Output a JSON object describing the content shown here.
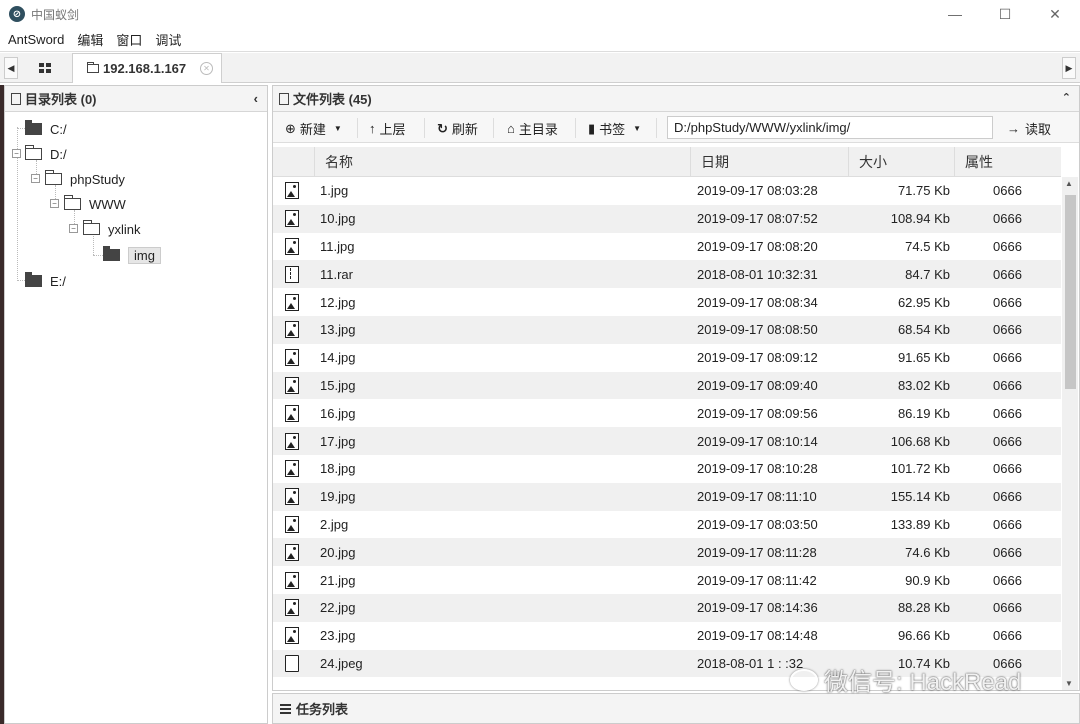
{
  "window": {
    "title": "中国蚁剑",
    "minimize": "—",
    "maximize": "☐",
    "close": "✕"
  },
  "menu": [
    "AntSword",
    "编辑",
    "窗口",
    "调试"
  ],
  "tabs": {
    "active_tab": "192.168.1.167",
    "left_arrow": "◀",
    "right_arrow": "▶"
  },
  "dir_panel": {
    "title": "目录列表 (0)",
    "collapse_icon": "‹",
    "tree": [
      {
        "label": "C:/"
      },
      {
        "label": "D:/"
      },
      {
        "label": "phpStudy"
      },
      {
        "label": "WWW"
      },
      {
        "label": "yxlink"
      },
      {
        "label": "img"
      },
      {
        "label": "E:/"
      }
    ]
  },
  "file_panel": {
    "title": "文件列表 (45)",
    "collapse_icon": "⌃",
    "toolbar": {
      "new_label": "新建",
      "up_label": "上层",
      "refresh_label": "刷新",
      "home_label": "主目录",
      "bookmark_label": "书签",
      "path_value": "D:/phpStudy/WWW/yxlink/img/",
      "read_label": "读取"
    },
    "columns": [
      "名称",
      "日期",
      "大小",
      "属性"
    ],
    "rows": [
      {
        "name": "1.jpg",
        "date": "2019-09-17 08:03:28",
        "size": "71.75 Kb",
        "attr": "0666",
        "icon": "image-file-icon"
      },
      {
        "name": "10.jpg",
        "date": "2019-09-17 08:07:52",
        "size": "108.94 Kb",
        "attr": "0666",
        "icon": "image-file-icon"
      },
      {
        "name": "11.jpg",
        "date": "2019-09-17 08:08:20",
        "size": "74.5 Kb",
        "attr": "0666",
        "icon": "image-file-icon"
      },
      {
        "name": "11.rar",
        "date": "2018-08-01 10:32:31",
        "size": "84.7 Kb",
        "attr": "0666",
        "icon": "archive-file-icon"
      },
      {
        "name": "12.jpg",
        "date": "2019-09-17 08:08:34",
        "size": "62.95 Kb",
        "attr": "0666",
        "icon": "image-file-icon"
      },
      {
        "name": "13.jpg",
        "date": "2019-09-17 08:08:50",
        "size": "68.54 Kb",
        "attr": "0666",
        "icon": "image-file-icon"
      },
      {
        "name": "14.jpg",
        "date": "2019-09-17 08:09:12",
        "size": "91.65 Kb",
        "attr": "0666",
        "icon": "image-file-icon"
      },
      {
        "name": "15.jpg",
        "date": "2019-09-17 08:09:40",
        "size": "83.02 Kb",
        "attr": "0666",
        "icon": "image-file-icon"
      },
      {
        "name": "16.jpg",
        "date": "2019-09-17 08:09:56",
        "size": "86.19 Kb",
        "attr": "0666",
        "icon": "image-file-icon"
      },
      {
        "name": "17.jpg",
        "date": "2019-09-17 08:10:14",
        "size": "106.68 Kb",
        "attr": "0666",
        "icon": "image-file-icon"
      },
      {
        "name": "18.jpg",
        "date": "2019-09-17 08:10:28",
        "size": "101.72 Kb",
        "attr": "0666",
        "icon": "image-file-icon"
      },
      {
        "name": "19.jpg",
        "date": "2019-09-17 08:11:10",
        "size": "155.14 Kb",
        "attr": "0666",
        "icon": "image-file-icon"
      },
      {
        "name": "2.jpg",
        "date": "2019-09-17 08:03:50",
        "size": "133.89 Kb",
        "attr": "0666",
        "icon": "image-file-icon"
      },
      {
        "name": "20.jpg",
        "date": "2019-09-17 08:11:28",
        "size": "74.6 Kb",
        "attr": "0666",
        "icon": "image-file-icon"
      },
      {
        "name": "21.jpg",
        "date": "2019-09-17 08:11:42",
        "size": "90.9 Kb",
        "attr": "0666",
        "icon": "image-file-icon"
      },
      {
        "name": "22.jpg",
        "date": "2019-09-17 08:14:36",
        "size": "88.28 Kb",
        "attr": "0666",
        "icon": "image-file-icon"
      },
      {
        "name": "23.jpg",
        "date": "2019-09-17 08:14:48",
        "size": "96.66 Kb",
        "attr": "0666",
        "icon": "image-file-icon"
      },
      {
        "name": "24.jpeg",
        "date": "2018-08-01 1 : :32",
        "size": "10.74 Kb",
        "attr": "0666",
        "icon": "file-icon"
      }
    ]
  },
  "task_panel": {
    "title": "任务列表"
  },
  "watermark": "微信号: HackRead"
}
